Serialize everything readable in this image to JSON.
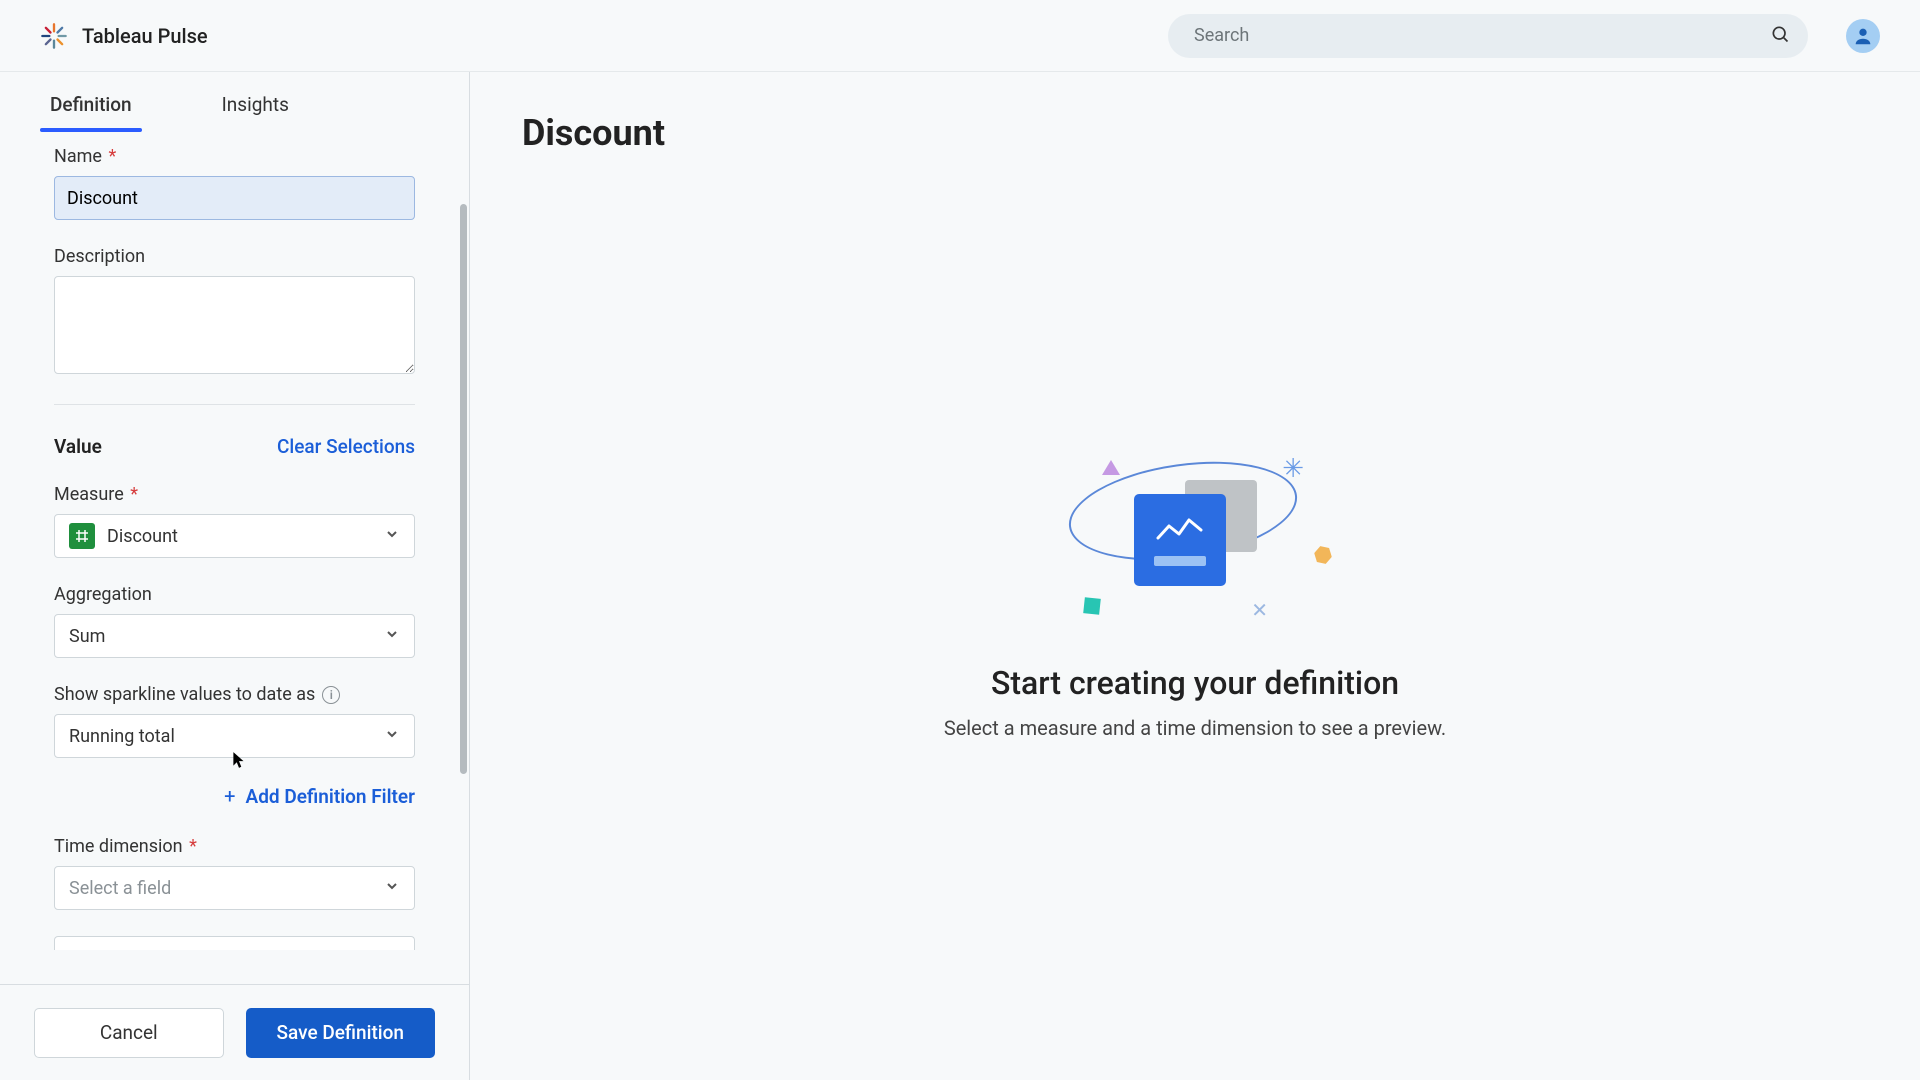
{
  "header": {
    "app_title": "Tableau Pulse",
    "search_placeholder": "Search"
  },
  "tabs": {
    "definition": "Definition",
    "insights": "Insights"
  },
  "form": {
    "name_label": "Name",
    "name_value": "Discount",
    "description_label": "Description",
    "description_value": "",
    "value_section": "Value",
    "clear_selections": "Clear Selections",
    "measure_label": "Measure",
    "measure_value": "Discount",
    "aggregation_label": "Aggregation",
    "aggregation_value": "Sum",
    "sparkline_label": "Show sparkline values to date as",
    "sparkline_value": "Running total",
    "add_filter": "Add Definition Filter",
    "time_dim_label": "Time dimension",
    "time_dim_placeholder": "Select a field"
  },
  "footer": {
    "cancel": "Cancel",
    "save": "Save Definition"
  },
  "content": {
    "title": "Discount",
    "empty_title": "Start creating your definition",
    "empty_sub": "Select a measure and a time dimension to see a preview."
  }
}
